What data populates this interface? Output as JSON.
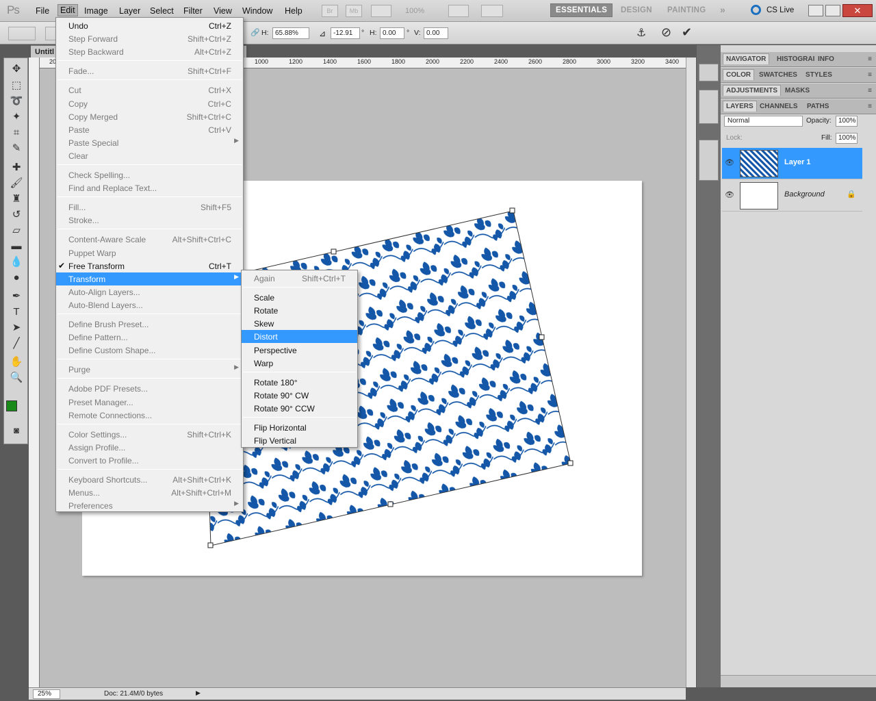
{
  "menubar": {
    "logo": "Ps",
    "items": [
      "File",
      "Edit",
      "Image",
      "Layer",
      "Select",
      "Filter",
      "View",
      "Window",
      "Help"
    ],
    "zoom": "100%",
    "workspaces": [
      "ESSENTIALS",
      "DESIGN",
      "PAINTING"
    ],
    "more": "»",
    "cs_live": "CS Live"
  },
  "options": {
    "w_label": "H:",
    "w_value": "65.88%",
    "angle_value": "-12.91",
    "h_label": "H:",
    "h_value": "0.00",
    "v_label": "V:",
    "v_value": "0.00",
    "deg": "°"
  },
  "doc": {
    "tab_title": "Untitl",
    "ruler_ticks": [
      "20",
      "1000",
      "1200",
      "1400",
      "1600",
      "1800",
      "2000",
      "2200",
      "2400",
      "2600",
      "2800",
      "3000",
      "3200",
      "3400"
    ],
    "zoom": "25%",
    "doc_size": "Doc: 21.4M/0 bytes"
  },
  "edit_menu": {
    "items": [
      {
        "label": "Undo",
        "shortcut": "Ctrl+Z",
        "enabled": true
      },
      {
        "label": "Step Forward",
        "shortcut": "Shift+Ctrl+Z",
        "enabled": false
      },
      {
        "label": "Step Backward",
        "shortcut": "Alt+Ctrl+Z",
        "enabled": false
      },
      {
        "sep": true
      },
      {
        "label": "Fade...",
        "shortcut": "Shift+Ctrl+F",
        "enabled": false
      },
      {
        "sep": true
      },
      {
        "label": "Cut",
        "shortcut": "Ctrl+X",
        "enabled": false
      },
      {
        "label": "Copy",
        "shortcut": "Ctrl+C",
        "enabled": false
      },
      {
        "label": "Copy Merged",
        "shortcut": "Shift+Ctrl+C",
        "enabled": false
      },
      {
        "label": "Paste",
        "shortcut": "Ctrl+V",
        "enabled": false
      },
      {
        "label": "Paste Special",
        "shortcut": "",
        "enabled": false,
        "submenu": true
      },
      {
        "label": "Clear",
        "shortcut": "",
        "enabled": false
      },
      {
        "sep": true
      },
      {
        "label": "Check Spelling...",
        "shortcut": "",
        "enabled": false
      },
      {
        "label": "Find and Replace Text...",
        "shortcut": "",
        "enabled": false
      },
      {
        "sep": true
      },
      {
        "label": "Fill...",
        "shortcut": "Shift+F5",
        "enabled": false
      },
      {
        "label": "Stroke...",
        "shortcut": "",
        "enabled": false
      },
      {
        "sep": true
      },
      {
        "label": "Content-Aware Scale",
        "shortcut": "Alt+Shift+Ctrl+C",
        "enabled": false
      },
      {
        "label": "Puppet Warp",
        "shortcut": "",
        "enabled": false
      },
      {
        "label": "Free Transform",
        "shortcut": "Ctrl+T",
        "enabled": true,
        "checked": true
      },
      {
        "label": "Transform",
        "shortcut": "",
        "enabled": true,
        "submenu": true,
        "highlight": true
      },
      {
        "label": "Auto-Align Layers...",
        "shortcut": "",
        "enabled": false
      },
      {
        "label": "Auto-Blend Layers...",
        "shortcut": "",
        "enabled": false
      },
      {
        "sep": true
      },
      {
        "label": "Define Brush Preset...",
        "shortcut": "",
        "enabled": false
      },
      {
        "label": "Define Pattern...",
        "shortcut": "",
        "enabled": false
      },
      {
        "label": "Define Custom Shape...",
        "shortcut": "",
        "enabled": false
      },
      {
        "sep": true
      },
      {
        "label": "Purge",
        "shortcut": "",
        "enabled": false,
        "submenu": true
      },
      {
        "sep": true
      },
      {
        "label": "Adobe PDF Presets...",
        "shortcut": "",
        "enabled": false
      },
      {
        "label": "Preset Manager...",
        "shortcut": "",
        "enabled": false
      },
      {
        "label": "Remote Connections...",
        "shortcut": "",
        "enabled": false
      },
      {
        "sep": true
      },
      {
        "label": "Color Settings...",
        "shortcut": "Shift+Ctrl+K",
        "enabled": false
      },
      {
        "label": "Assign Profile...",
        "shortcut": "",
        "enabled": false
      },
      {
        "label": "Convert to Profile...",
        "shortcut": "",
        "enabled": false
      },
      {
        "sep": true
      },
      {
        "label": "Keyboard Shortcuts...",
        "shortcut": "Alt+Shift+Ctrl+K",
        "enabled": false
      },
      {
        "label": "Menus...",
        "shortcut": "Alt+Shift+Ctrl+M",
        "enabled": false
      },
      {
        "label": "Preferences",
        "shortcut": "",
        "enabled": false,
        "submenu": true
      }
    ]
  },
  "transform_menu": {
    "items": [
      {
        "label": "Again",
        "shortcut": "Shift+Ctrl+T",
        "enabled": false
      },
      {
        "sep": true
      },
      {
        "label": "Scale",
        "enabled": true
      },
      {
        "label": "Rotate",
        "enabled": true
      },
      {
        "label": "Skew",
        "enabled": true
      },
      {
        "label": "Distort",
        "enabled": true,
        "highlight": true
      },
      {
        "label": "Perspective",
        "enabled": true
      },
      {
        "label": "Warp",
        "enabled": true
      },
      {
        "sep": true
      },
      {
        "label": "Rotate 180°",
        "enabled": true
      },
      {
        "label": "Rotate 90° CW",
        "enabled": true
      },
      {
        "label": "Rotate 90° CCW",
        "enabled": true
      },
      {
        "sep": true
      },
      {
        "label": "Flip Horizontal",
        "enabled": true
      },
      {
        "label": "Flip Vertical",
        "enabled": true
      }
    ]
  },
  "panels": {
    "row1": [
      "NAVIGATOR",
      "HISTOGRAI",
      "INFO"
    ],
    "row2": [
      "COLOR",
      "SWATCHES",
      "STYLES"
    ],
    "row3": [
      "ADJUSTMENTS",
      "MASKS"
    ],
    "row4": [
      "LAYERS",
      "CHANNELS",
      "PATHS"
    ],
    "blend_mode": "Normal",
    "opacity_label": "Opacity:",
    "opacity": "100%",
    "lock_label": "Lock:",
    "fill_label": "Fill:",
    "fill": "100%",
    "layers": [
      {
        "name": "Layer 1",
        "selected": true
      },
      {
        "name": "Background",
        "selected": false
      }
    ]
  },
  "colors": {
    "accent": "#3399ff",
    "pattern": "#1457a8",
    "foreground": "#1a8a1a"
  }
}
